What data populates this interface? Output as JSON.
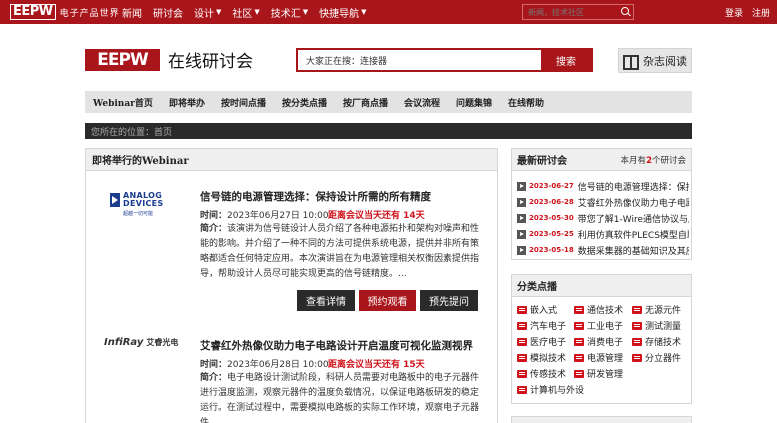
{
  "topbar": {
    "logo_mark": "EEPW",
    "logo_slogan": "电子产品世界",
    "nav": [
      {
        "label": "新闻",
        "caret": false
      },
      {
        "label": "研讨会",
        "caret": false
      },
      {
        "label": "设计",
        "caret": true
      },
      {
        "label": "社区",
        "caret": true
      },
      {
        "label": "技术汇",
        "caret": true
      },
      {
        "label": "快捷导航",
        "caret": true
      }
    ],
    "search_placeholder": "新闻，技术社区",
    "login": "登录",
    "register": "注册"
  },
  "header": {
    "logo": "EEPW",
    "title": "在线研讨会",
    "search_value": "大家正在搜：连接器",
    "search_button": "搜索",
    "magazine": "杂志阅读"
  },
  "mainnav": [
    "Webinar首页",
    "即将举办",
    "按时间点播",
    "按分类点播",
    "按厂商点播",
    "会议流程",
    "问题集锦",
    "在线帮助"
  ],
  "breadcrumb": "您所在的位置：首页",
  "upcoming": {
    "heading": "即将举行的Webinar",
    "items": [
      {
        "logo_line1": "ANALOG",
        "logo_line2": "DEVICES",
        "logo_tag": "超越一切可能",
        "title": "信号链的电源管理选择：保持设计所需的所有精度",
        "time_label": "时间：",
        "time": "2023年06月27日 10:00",
        "countdown": "距离会议当天还有 14天",
        "desc_label": "简介：",
        "desc": "该演讲为信号链设计人员介绍了各种电源拓扑和架构对噪声和性能的影响。并介绍了一种不同的方法可提供系统电源，提供并非所有策略都适合任何特定应用。本次演讲旨在为电源管理相关权衡因素提供指导，帮助设计人员尽可能实现更高的信号链精度。...",
        "btn_detail": "查看详情",
        "btn_reserve": "预约观看",
        "btn_question": "预先提问"
      },
      {
        "logo_line1": "InfiRay",
        "logo_line2": "艾睿光电",
        "title": "艾睿红外热像仪助力电子电路设计开启温度可视化监测视界",
        "time_label": "时间：",
        "time": "2023年06月28日 10:00",
        "countdown": "距离会议当天还有 15天",
        "desc_label": "简介：",
        "desc": "电子电路设计测试阶段，科研人员需要对电路板中的电子元器件进行温度监测，观察元器件的温度负载情况，以保证电路板研发的稳定运行。在测试过程中，需要模拟电路板的实际工作环境，观察电子元器件"
      }
    ]
  },
  "recent": {
    "heading": "最新研讨会",
    "summary_prefix": "本月有",
    "summary_count": "2",
    "summary_suffix": "个研讨会",
    "items": [
      {
        "date": "2023-06-27",
        "title": "信号链的电源管理选择：保持"
      },
      {
        "date": "2023-06-28",
        "title": "艾睿红外热像仪助力电子电路..."
      },
      {
        "date": "2023-05-30",
        "title": "带您了解1-Wire通信协议与应用"
      },
      {
        "date": "2023-05-25",
        "title": "利用仿真软件PLECS模型自助生"
      },
      {
        "date": "2023-05-18",
        "title": "数据采集器的基础知识及其应"
      }
    ]
  },
  "categories": {
    "heading": "分类点播",
    "items": [
      "嵌入式",
      "通信技术",
      "无源元件",
      "汽车电子",
      "工业电子",
      "测试测量",
      "医疗电子",
      "消费电子",
      "存储技术",
      "模拟技术",
      "电源管理",
      "分立器件",
      "传感技术",
      "研发管理",
      "计算机与外设"
    ]
  },
  "colors": {
    "brand_red": "#a8161b",
    "accent_red": "#d0131b",
    "dark": "#2a2a2a"
  }
}
